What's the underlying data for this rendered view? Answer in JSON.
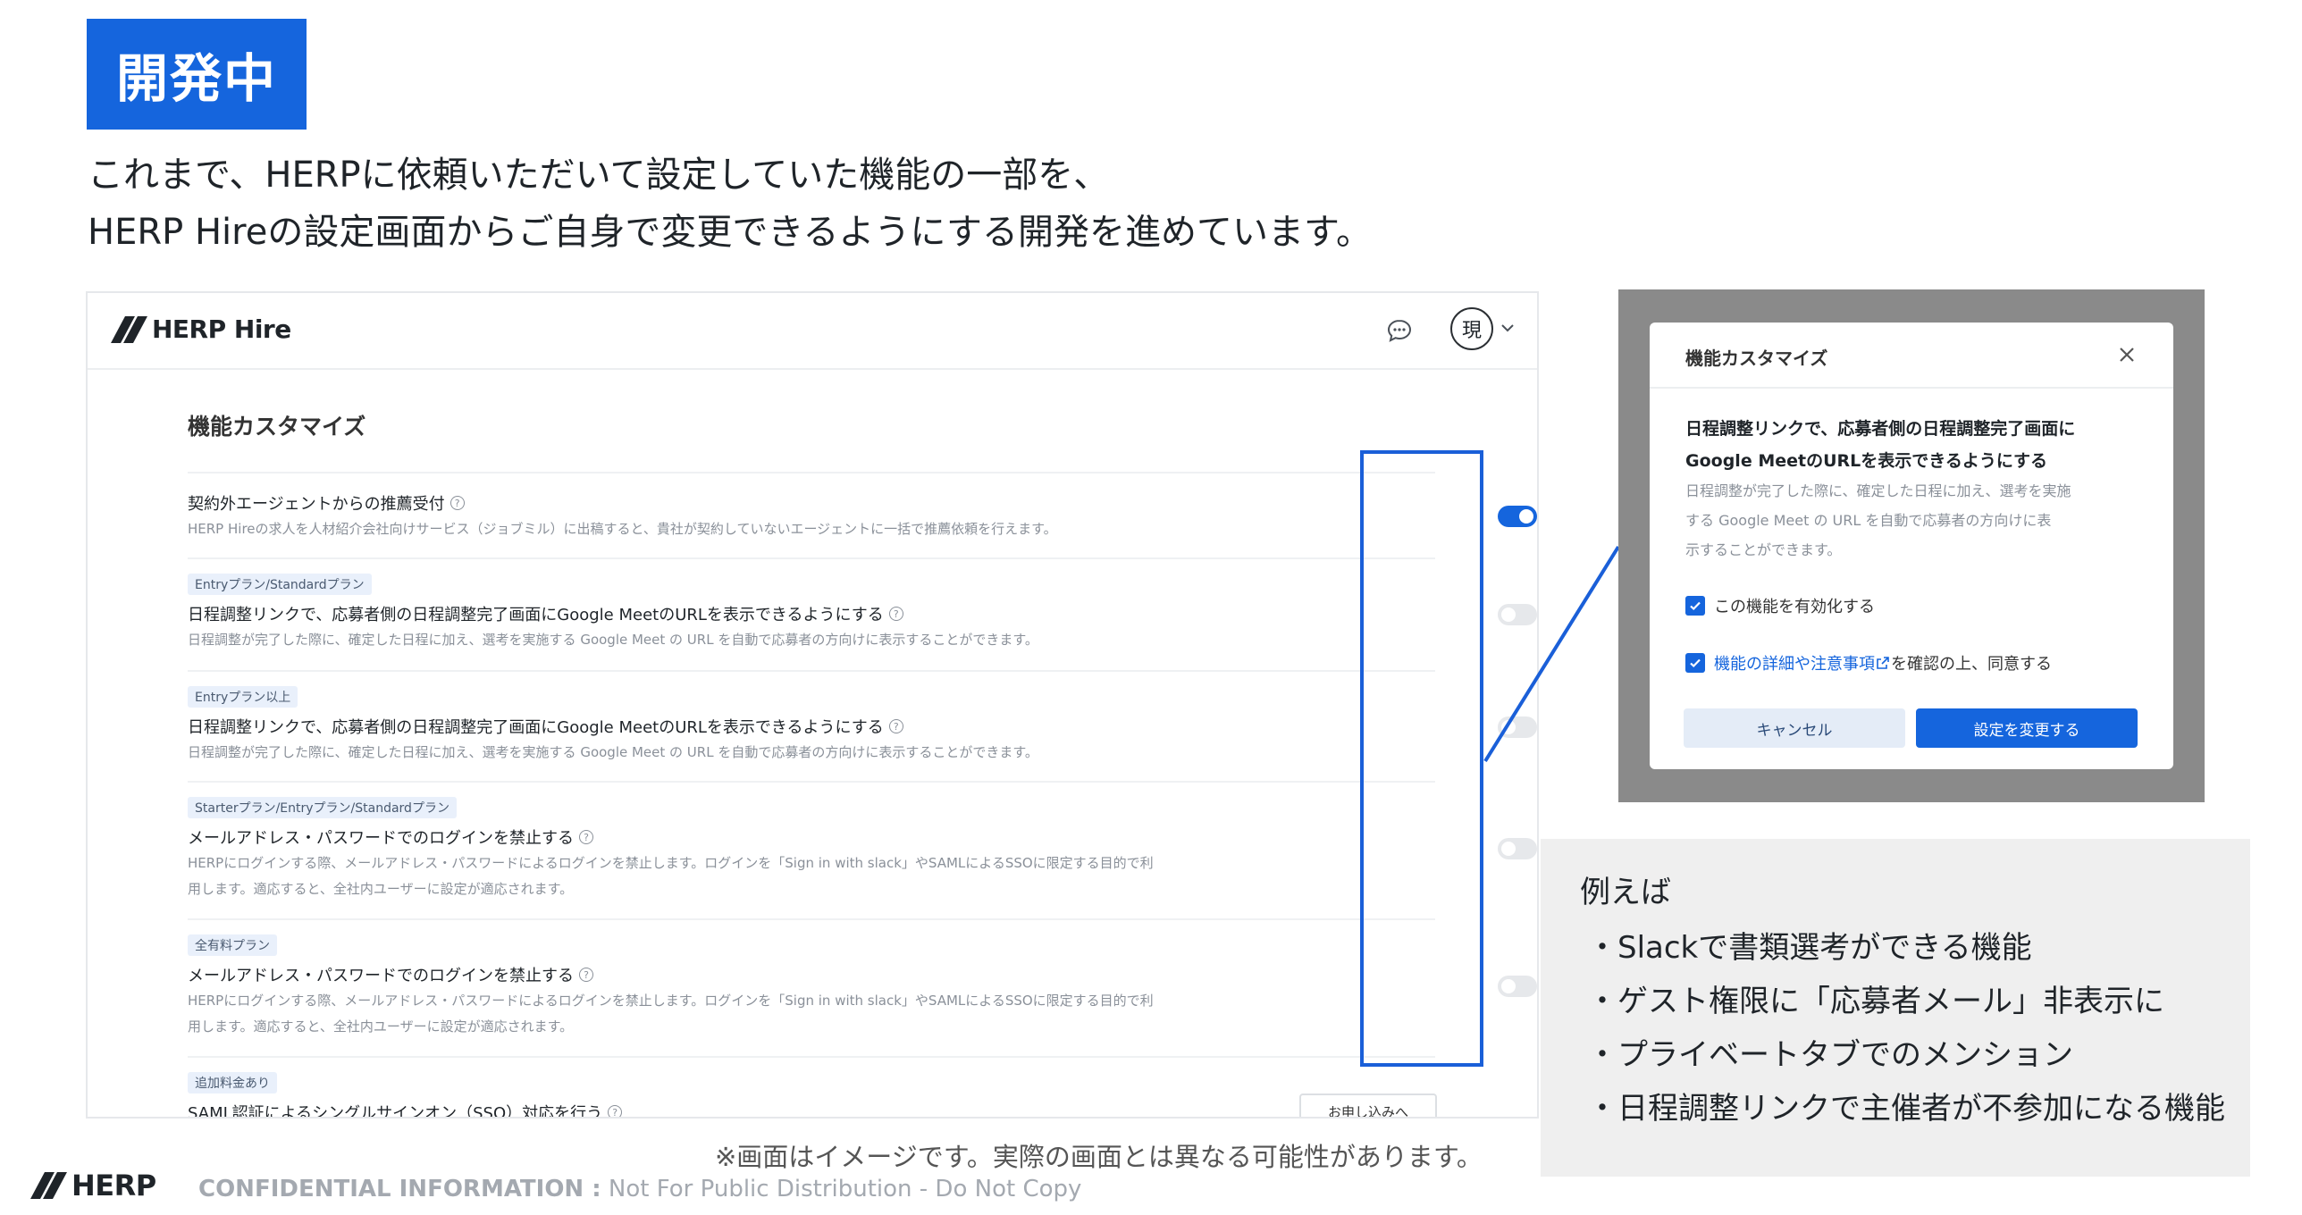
{
  "badge": "開発中",
  "intro": {
    "line1": "これまで、HERPに依頼いただいて設定していた機能の一部を、",
    "line2": "HERP Hireの設定画面からご自身で変更できるようにする開発を進めています。"
  },
  "app": {
    "logo_text": "HERP Hire",
    "avatar_text": "現",
    "section_title": "機能カスタマイズ",
    "rows": [
      {
        "tag": "",
        "title": "契約外エージェントからの推薦受付",
        "desc1": "HERP Hireの求人を人材紹介会社向けサービス（ジョブミル）に出稿すると、貴社が契約していないエージェントに一括で推薦依頼を行えます。",
        "desc2": "",
        "enabled": true
      },
      {
        "tag": "Entryプラン/Standardプラン",
        "title": "日程調整リンクで、応募者側の日程調整完了画面にGoogle MeetのURLを表示できるようにする",
        "desc1": "日程調整が完了した際に、確定した日程に加え、選考を実施する Google Meet の URL を自動で応募者の方向けに表示することができます。",
        "desc2": "",
        "enabled": false
      },
      {
        "tag": "Entryプラン以上",
        "title": "日程調整リンクで、応募者側の日程調整完了画面にGoogle MeetのURLを表示できるようにする",
        "desc1": "日程調整が完了した際に、確定した日程に加え、選考を実施する Google Meet の URL を自動で応募者の方向けに表示することができます。",
        "desc2": "",
        "enabled": false
      },
      {
        "tag": "Starterプラン/Entryプラン/Standardプラン",
        "title": "メールアドレス・パスワードでのログインを禁止する",
        "desc1": "HERPにログインする際、メールアドレス・パスワードによるログインを禁止します。ログインを「Sign in with slack」やSAMLによるSSOに限定する目的で利",
        "desc2": "用します。適応すると、全社内ユーザーに設定が適応されます。",
        "enabled": false
      },
      {
        "tag": "全有料プラン",
        "title": "メールアドレス・パスワードでのログインを禁止する",
        "desc1": "HERPにログインする際、メールアドレス・パスワードによるログインを禁止します。ログインを「Sign in with slack」やSAMLによるSSOに限定する目的で利",
        "desc2": "用します。適応すると、全社内ユーザーに設定が適応されます。",
        "enabled": false
      }
    ],
    "last_row": {
      "tag": "追加料金あり",
      "title": "SAML認証によるシングルサインオン（SSO）対応を行う",
      "button": "お申し込みへ"
    }
  },
  "modal": {
    "title": "機能カスタマイズ",
    "heading1": "日程調整リンクで、応募者側の日程調整完了画面に",
    "heading2": "Google MeetのURLを表示できるようにする",
    "desc1": "日程調整が完了した際に、確定した日程に加え、選考を実施",
    "desc2": "する Google Meet の URL を自動で応募者の方向けに表",
    "desc3": "示することができます。",
    "check1": "この機能を有効化する",
    "check2_link": "機能の詳細や注意事項",
    "check2_rest": "を確認の上、同意する",
    "cancel": "キャンセル",
    "submit": "設定を変更する"
  },
  "examples": {
    "heading": "例えば",
    "items": [
      "・Slackで書類選考ができる機能",
      "・ゲスト権限に「応募者メール」非表示に",
      "・プライベートタブでのメンション",
      "・日程調整リンクで主催者が不参加になる機能"
    ]
  },
  "note": "※画面はイメージです。実際の画面とは異なる可能性があります。",
  "footer": {
    "logo_text": "HERP",
    "label": "CONFIDENTIAL INFORMATION :",
    "text": " Not For Public Distribution - Do Not Copy"
  },
  "colors": {
    "accent": "#1565dd",
    "highlight": "#1a5fd8",
    "tag_bg": "#e9f0fb",
    "modal_overlay": "#8a8a8a",
    "examples_bg": "#efefef"
  }
}
